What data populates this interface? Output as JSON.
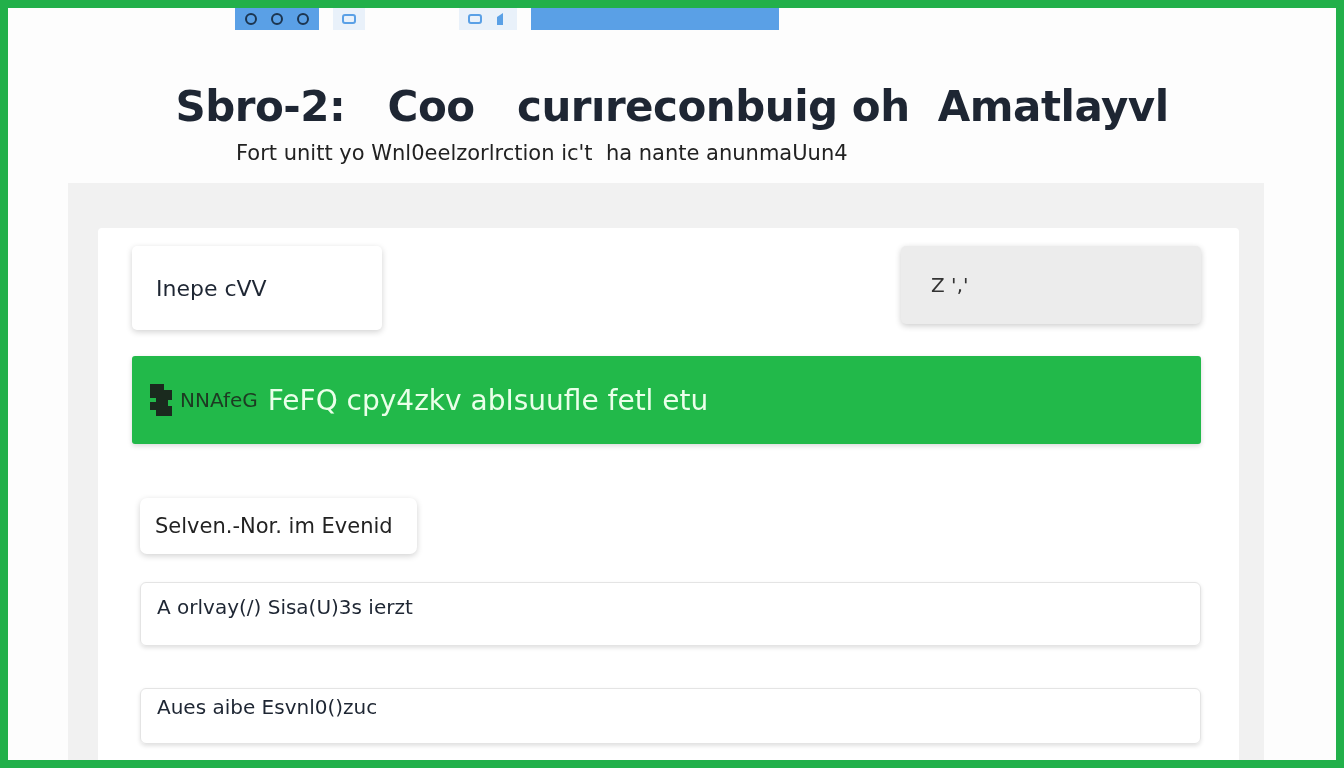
{
  "title": "Sbro-2:   Coo   curıreconbuig oh  Amatlayvl",
  "subtitle": "Fort unitt yo Wnl0eelzorlrction ic't  ha nante anunmaUun4",
  "fields": [
    {
      "kind": "white",
      "value": "Inepe cVV"
    },
    {
      "kind": "grey",
      "value": "Z '‚'"
    }
  ],
  "banner": {
    "label": "NNAfeG",
    "text": "FeFQ cpy4zkv abIsuufle fetl etu"
  },
  "button": "Selven.-Nor. im Evenid",
  "inputs": [
    {
      "value": "A orlvay(/) Sisa(U)3s ierzt"
    },
    {
      "value": "Aues aibe Esvnl0()zuc"
    }
  ]
}
